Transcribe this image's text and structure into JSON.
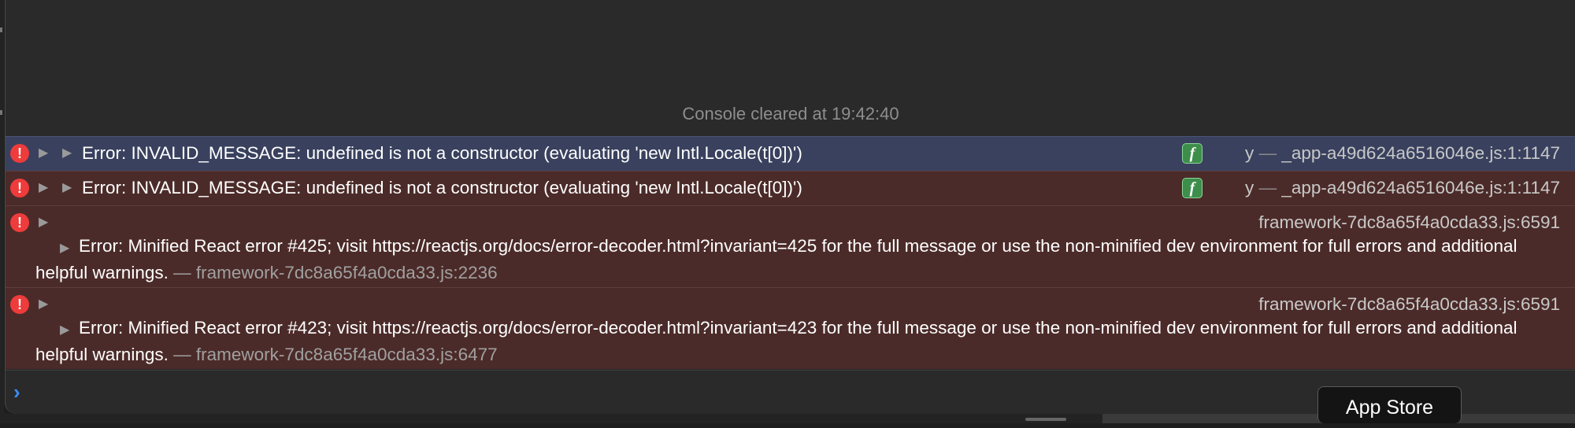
{
  "console": {
    "cleared_text": "Console cleared at 19:42:40",
    "messages": [
      {
        "text": "Error: INVALID_MESSAGE: undefined is not a constructor (evaluating 'new Intl.Locale(t[0])')",
        "function_badge": "f",
        "function_name": "y",
        "separator": "—",
        "source": "_app-a49d624a6516046e.js:1:1147",
        "selected": true
      },
      {
        "text": "Error: INVALID_MESSAGE: undefined is not a constructor (evaluating 'new Intl.Locale(t[0])')",
        "function_badge": "f",
        "function_name": "y",
        "separator": "—",
        "source": "_app-a49d624a6516046e.js:1:1147",
        "selected": false
      },
      {
        "source": "framework-7dc8a65f4a0cda33.js:6591",
        "text": "Error: Minified React error #425; visit https://reactjs.org/docs/error-decoder.html?invariant=425 for the full message or use the non-minified dev environment for full errors and additional helpful warnings.",
        "separator": "—",
        "inner_source": "framework-7dc8a65f4a0cda33.js:2236"
      },
      {
        "source": "framework-7dc8a65f4a0cda33.js:6591",
        "text": "Error: Minified React error #423; visit https://reactjs.org/docs/error-decoder.html?invariant=423 for the full message or use the non-minified dev environment for full errors and additional helpful warnings.",
        "separator": "—",
        "inner_source": "framework-7dc8a65f4a0cda33.js:6477"
      }
    ],
    "error_icon_glyph": "!",
    "expand_glyph": "▶",
    "prompt_glyph": "›"
  },
  "dock_tooltip": {
    "label": "App Store"
  },
  "colors": {
    "error_row_bg": "#4b2b29",
    "selected_row_bg": "#39415e",
    "error_icon": "#ee3b3b",
    "prompt_accent": "#3d8cf3",
    "function_badge": "#3d8e4b"
  }
}
